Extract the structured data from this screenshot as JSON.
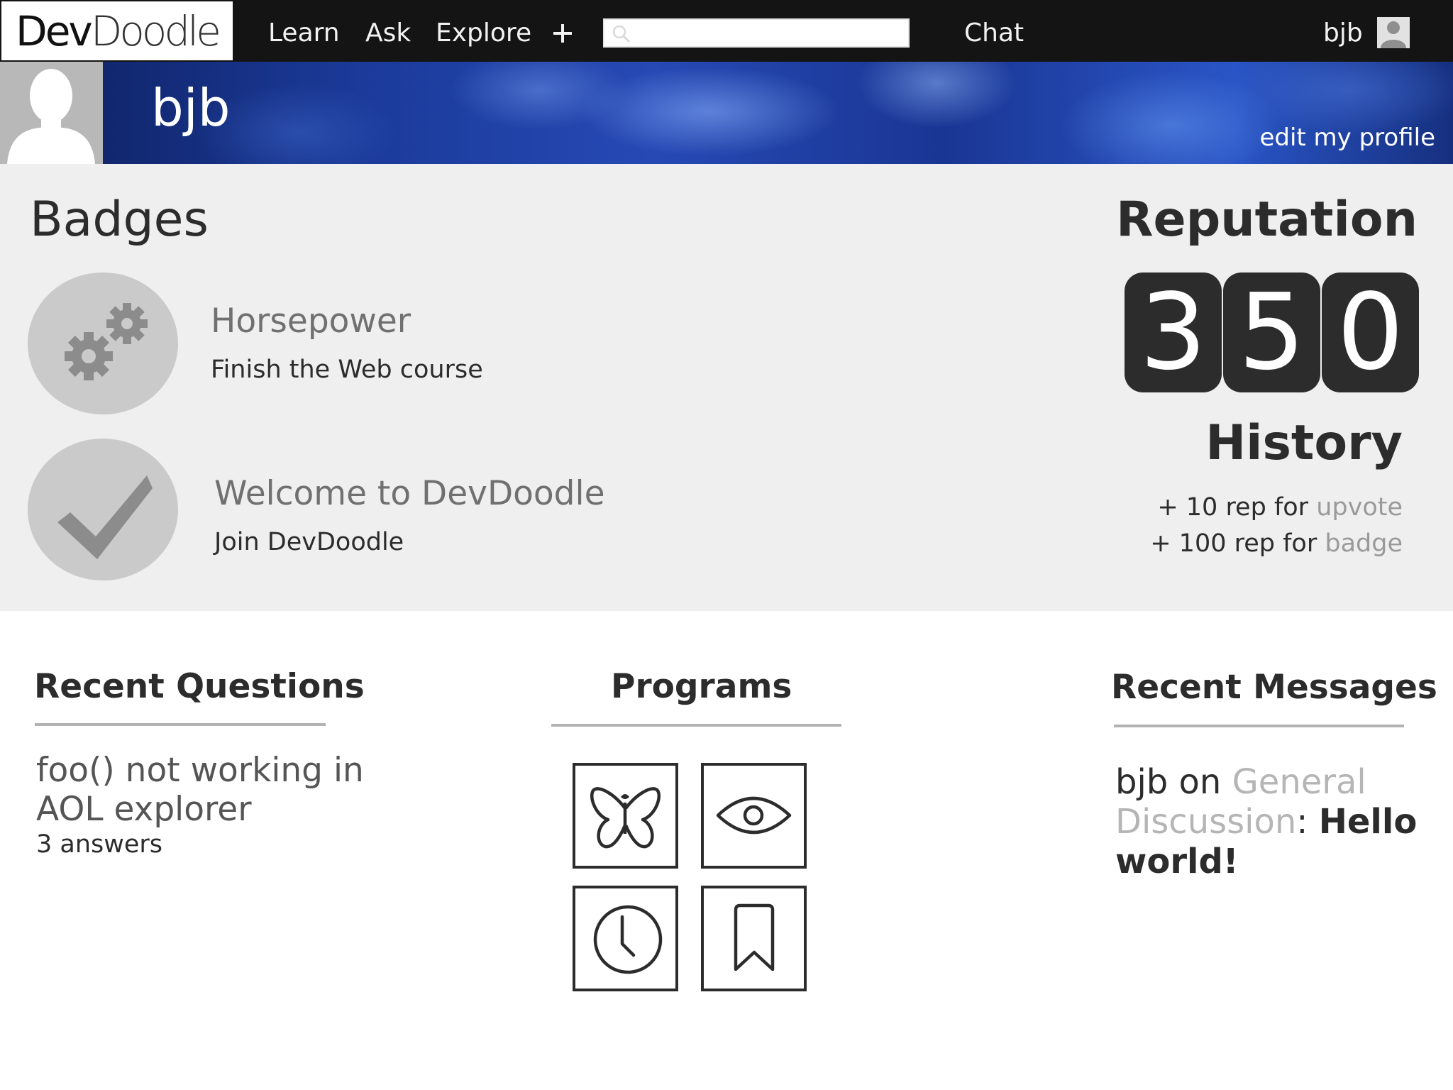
{
  "nav": {
    "logo_dev": "Dev",
    "logo_doodle": "Doodle",
    "learn": "Learn",
    "ask": "Ask",
    "explore": "Explore",
    "plus_icon": "plus-icon",
    "search_placeholder": "",
    "chat": "Chat",
    "username": "bjb"
  },
  "profile": {
    "name": "bjb",
    "edit_label": "edit my profile"
  },
  "badges": {
    "heading": "Badges",
    "items": [
      {
        "icon": "gears-icon",
        "title": "Horsepower",
        "description": "Finish the Web course"
      },
      {
        "icon": "checkmark-icon",
        "title": "Welcome to DevDoodle",
        "description": "Join DevDoodle"
      }
    ]
  },
  "reputation": {
    "heading": "Reputation",
    "value": 350,
    "digits": [
      "3",
      "5",
      "0"
    ],
    "history_heading": "History",
    "history": [
      {
        "prefix": "+ 10 rep for ",
        "reason": "upvote"
      },
      {
        "prefix": "+ 100 rep for ",
        "reason": "badge"
      }
    ]
  },
  "recent_questions": {
    "heading": "Recent Questions",
    "items": [
      {
        "title": "foo() not working in AOL explorer",
        "answers": "3 answers"
      }
    ]
  },
  "programs": {
    "heading": "Programs",
    "tiles": [
      "butterfly-icon",
      "eye-icon",
      "clock-icon",
      "bookmark-icon"
    ]
  },
  "recent_messages": {
    "heading": "Recent Messages",
    "items": [
      {
        "user": "bjb",
        "connector": " on ",
        "channel": "General Discussion",
        "separator": ": ",
        "text": "Hello world!"
      }
    ]
  },
  "colors": {
    "nav_bg": "#141414",
    "band_bg": "#efefef",
    "digit_bg": "#2c2c2c",
    "muted_text": "#707070",
    "link_gray": "#b5b5b5"
  }
}
